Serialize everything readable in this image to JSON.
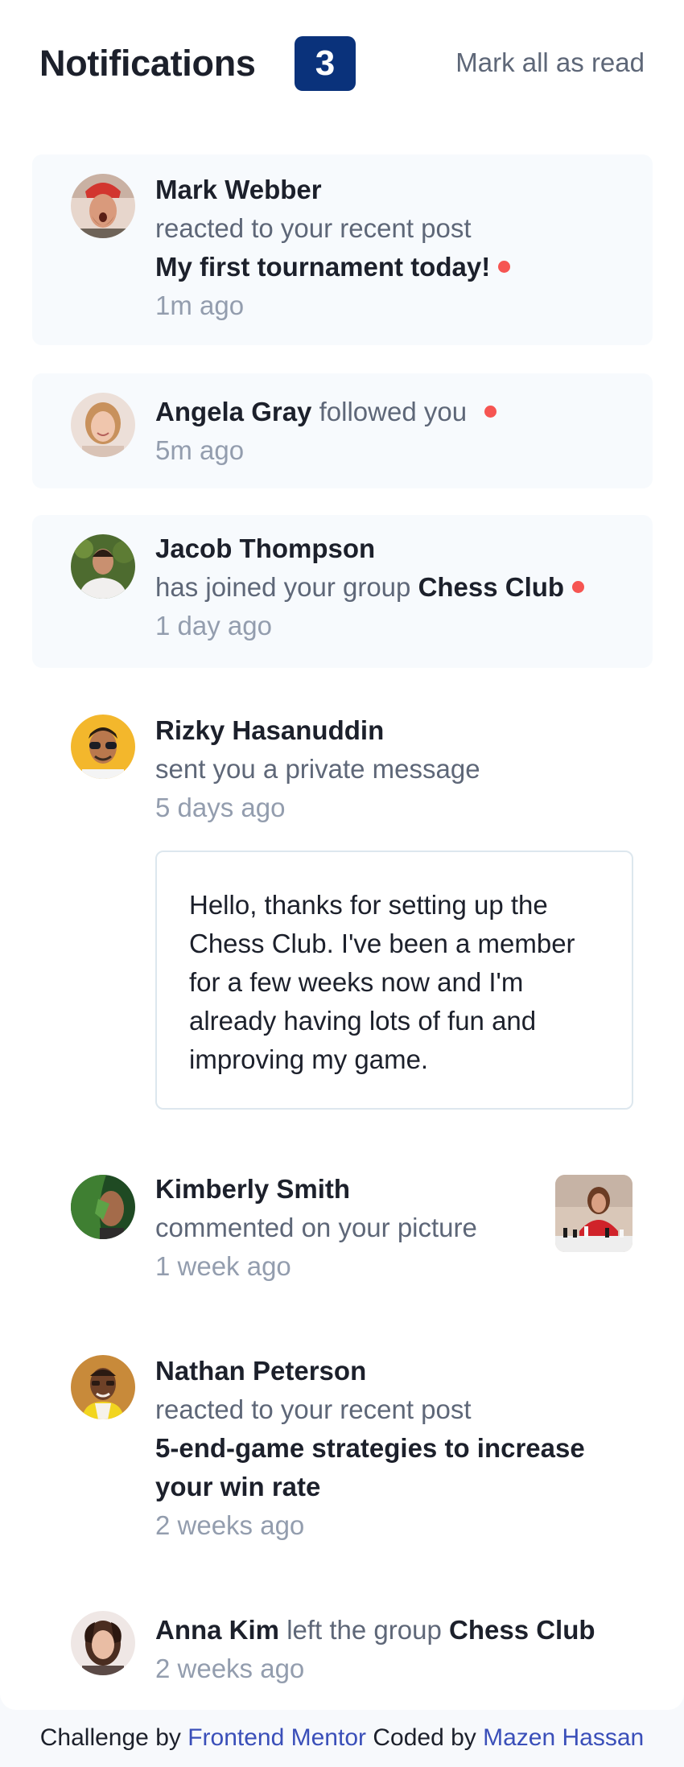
{
  "header": {
    "title": "Notifications",
    "unread_count": "3",
    "mark_all_label": "Mark all as read"
  },
  "notifications": [
    {
      "name": "Mark Webber",
      "action": "reacted to your recent post",
      "target": "My first tournament today!",
      "time": "1m ago",
      "unread": true
    },
    {
      "name": "Angela Gray",
      "action": "followed you",
      "time": "5m ago",
      "unread": true
    },
    {
      "name": "Jacob Thompson",
      "action": "has joined your group",
      "target": "Chess Club",
      "time": "1 day ago",
      "unread": true
    },
    {
      "name": "Rizky Hasanuddin",
      "action": "sent you a private message",
      "time": "5 days ago",
      "message": "Hello, thanks for setting up the Chess Club. I've been a member for a few weeks now and I'm already having lots of fun and improving my game.",
      "unread": false
    },
    {
      "name": "Kimberly Smith",
      "action": "commented on your picture",
      "time": "1 week ago",
      "unread": false
    },
    {
      "name": "Nathan Peterson",
      "action": "reacted to your recent post",
      "target": "5-end-game strategies to increase your win rate",
      "time": "2 weeks ago",
      "unread": false
    },
    {
      "name": "Anna Kim",
      "action": "left the group",
      "target": "Chess Club",
      "time": "2 weeks ago",
      "unread": false
    }
  ],
  "footer": {
    "challenge_prefix": "Challenge by",
    "challenge_link": "Frontend Mentor",
    "coded_prefix": "Coded by",
    "coded_link": "Mazen Hassan"
  },
  "colors": {
    "unread_dot": "#f65552",
    "badge_bg": "#0a327b",
    "footer_link": "#3a4fb9"
  },
  "icons": [
    "avatar-mark-webber",
    "avatar-angela-gray",
    "avatar-jacob-thompson",
    "avatar-rizky-hasanuddin",
    "avatar-kimberly-smith",
    "avatar-nathan-peterson",
    "avatar-anna-kim",
    "chess-picture-thumbnail",
    "unread-dot-icon"
  ]
}
